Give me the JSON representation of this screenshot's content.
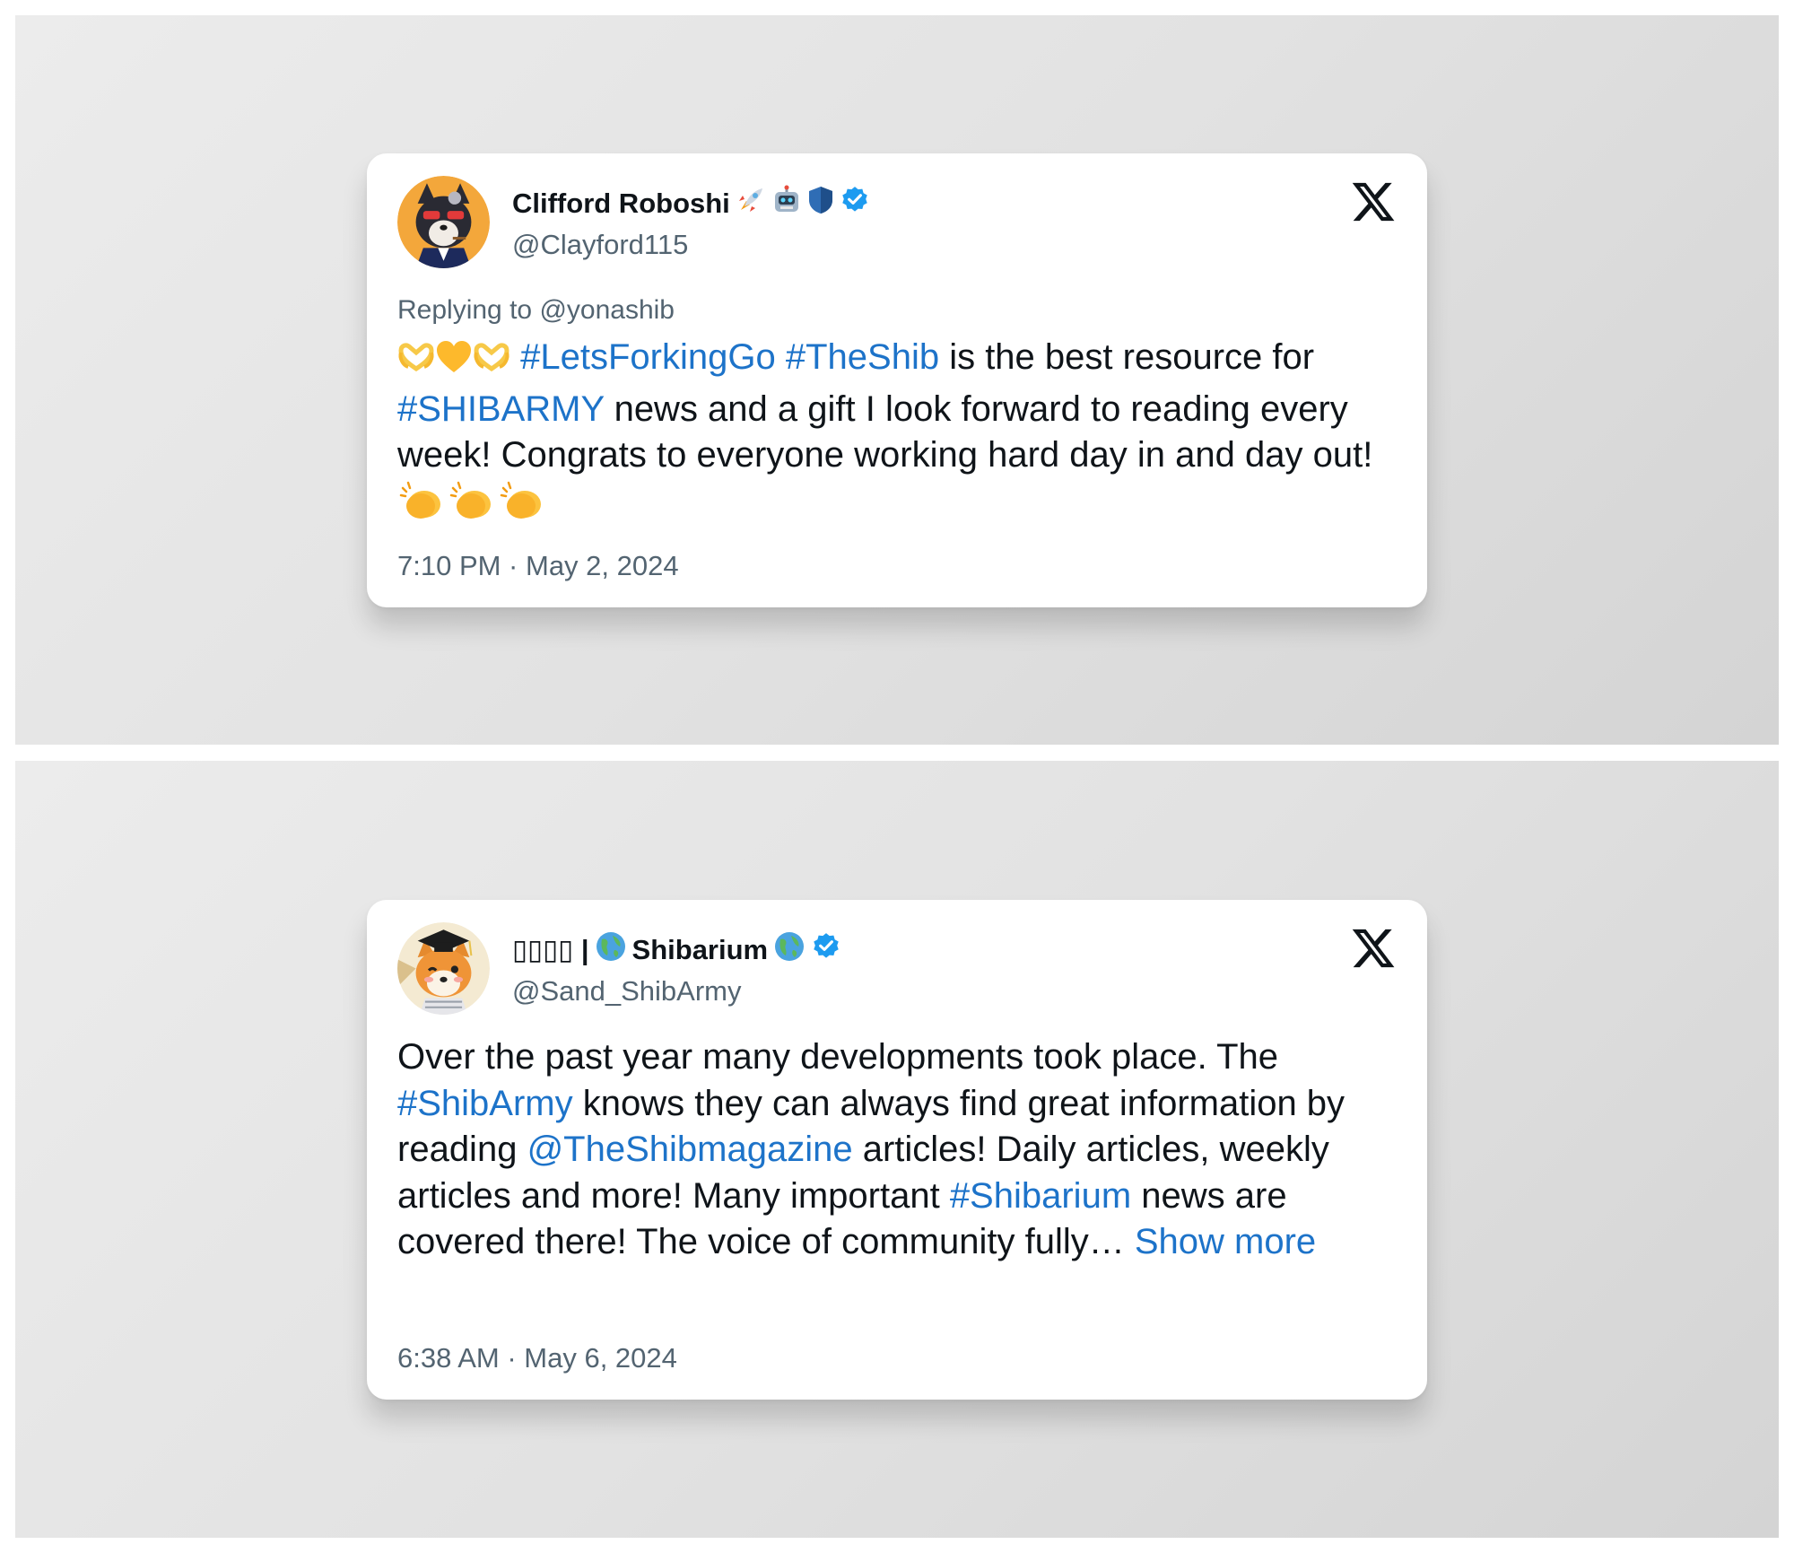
{
  "tweets": [
    {
      "display_name": "Clifford Roboshi",
      "name_emojis": [
        "rocket",
        "robot",
        "shield"
      ],
      "verified": true,
      "handle": "@Clayford115",
      "replying_to_prefix": "Replying to",
      "replying_to_handle": "@yonashib",
      "text": {
        "lead_emojis": [
          "heart-hands",
          "yellow-heart",
          "heart-hands"
        ],
        "hashtag1": "#LetsForkingGo",
        "hashtag2": "#TheShib",
        "part1": " is the best resource for ",
        "hashtag3": "#SHIBARMY",
        "part2": " news and a gift I look forward to reading every week! Congrats to everyone working hard day in and day out! ",
        "trail_emojis": [
          "clapping-hands",
          "clapping-hands",
          "clapping-hands"
        ]
      },
      "timestamp": "7:10 PM · May 2, 2024"
    },
    {
      "display_name_prefix": "▯▯▯▯ |",
      "display_name": "Shibarium",
      "name_emojis": [
        "globe",
        "globe"
      ],
      "verified": true,
      "handle": "@Sand_ShibArmy",
      "text": {
        "part1": "Over the past year many developments took place. The ",
        "hashtag1": "#ShibArmy",
        "part2": " knows they can always find great information by reading ",
        "mention1": "@TheShibmagazine",
        "part3": " articles! Daily articles, weekly articles and more! Many important ",
        "hashtag2": "#Shibarium",
        "part4": " news are covered there! The voice of community fully… ",
        "show_more": "Show more"
      },
      "timestamp": "6:38 AM · May 6, 2024"
    }
  ],
  "colors": {
    "link": "#1d73c9",
    "muted": "#536471",
    "text": "#0f1419",
    "verified_badge": "#1d9bf0"
  }
}
